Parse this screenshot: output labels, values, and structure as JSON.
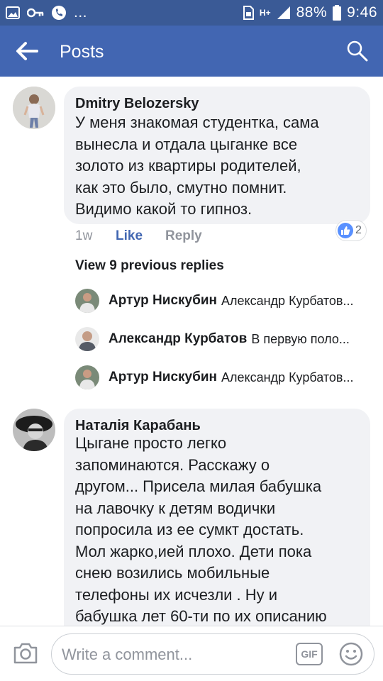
{
  "status_bar": {
    "battery": "88%",
    "time": "9:46",
    "ellipsis": "...",
    "network": "H+"
  },
  "header": {
    "title": "Posts"
  },
  "comments": [
    {
      "author": "Dmitry  Belozersky",
      "lines": [
        "У меня знакомая студентка, сама",
        "вынесла  и отдала  цыганке все",
        "золото из квартиры родителей,",
        "как  это  было, смутно помнит.",
        "Видимо какой то гипноз."
      ],
      "time": "1w",
      "like_label": "Like",
      "reply_label": "Reply",
      "reaction_count": "2"
    },
    {
      "author": "Наталія Карабань",
      "lines": [
        "Цыгане просто легко",
        "запоминаются. Расскажу о",
        "другом... Присела милая бабушка",
        "на лавочку к детям водички",
        "попросила из ее сумкт достать.",
        "Мол жарко,ией плохо. Дети пока",
        "снею возились мобильные",
        "телефоны их исчезли . Ну и",
        "бабушка лет 60-ти по их описанию"
      ]
    }
  ],
  "view_replies": "View 9 previous replies",
  "replies": [
    {
      "name": "Артур Нискубин",
      "text": "Александр Курбатов..."
    },
    {
      "name": "Александр Курбатов",
      "text": "В первую поло..."
    },
    {
      "name": "Артур Нискубин",
      "text": "Александр Курбатов..."
    }
  ],
  "composer": {
    "placeholder": "Write a comment...",
    "gif_label": "GIF"
  },
  "colors": {
    "status_bar": "#3a5a96",
    "header": "#4266b2",
    "link": "#4267b2",
    "bubble": "#f1f2f5"
  }
}
